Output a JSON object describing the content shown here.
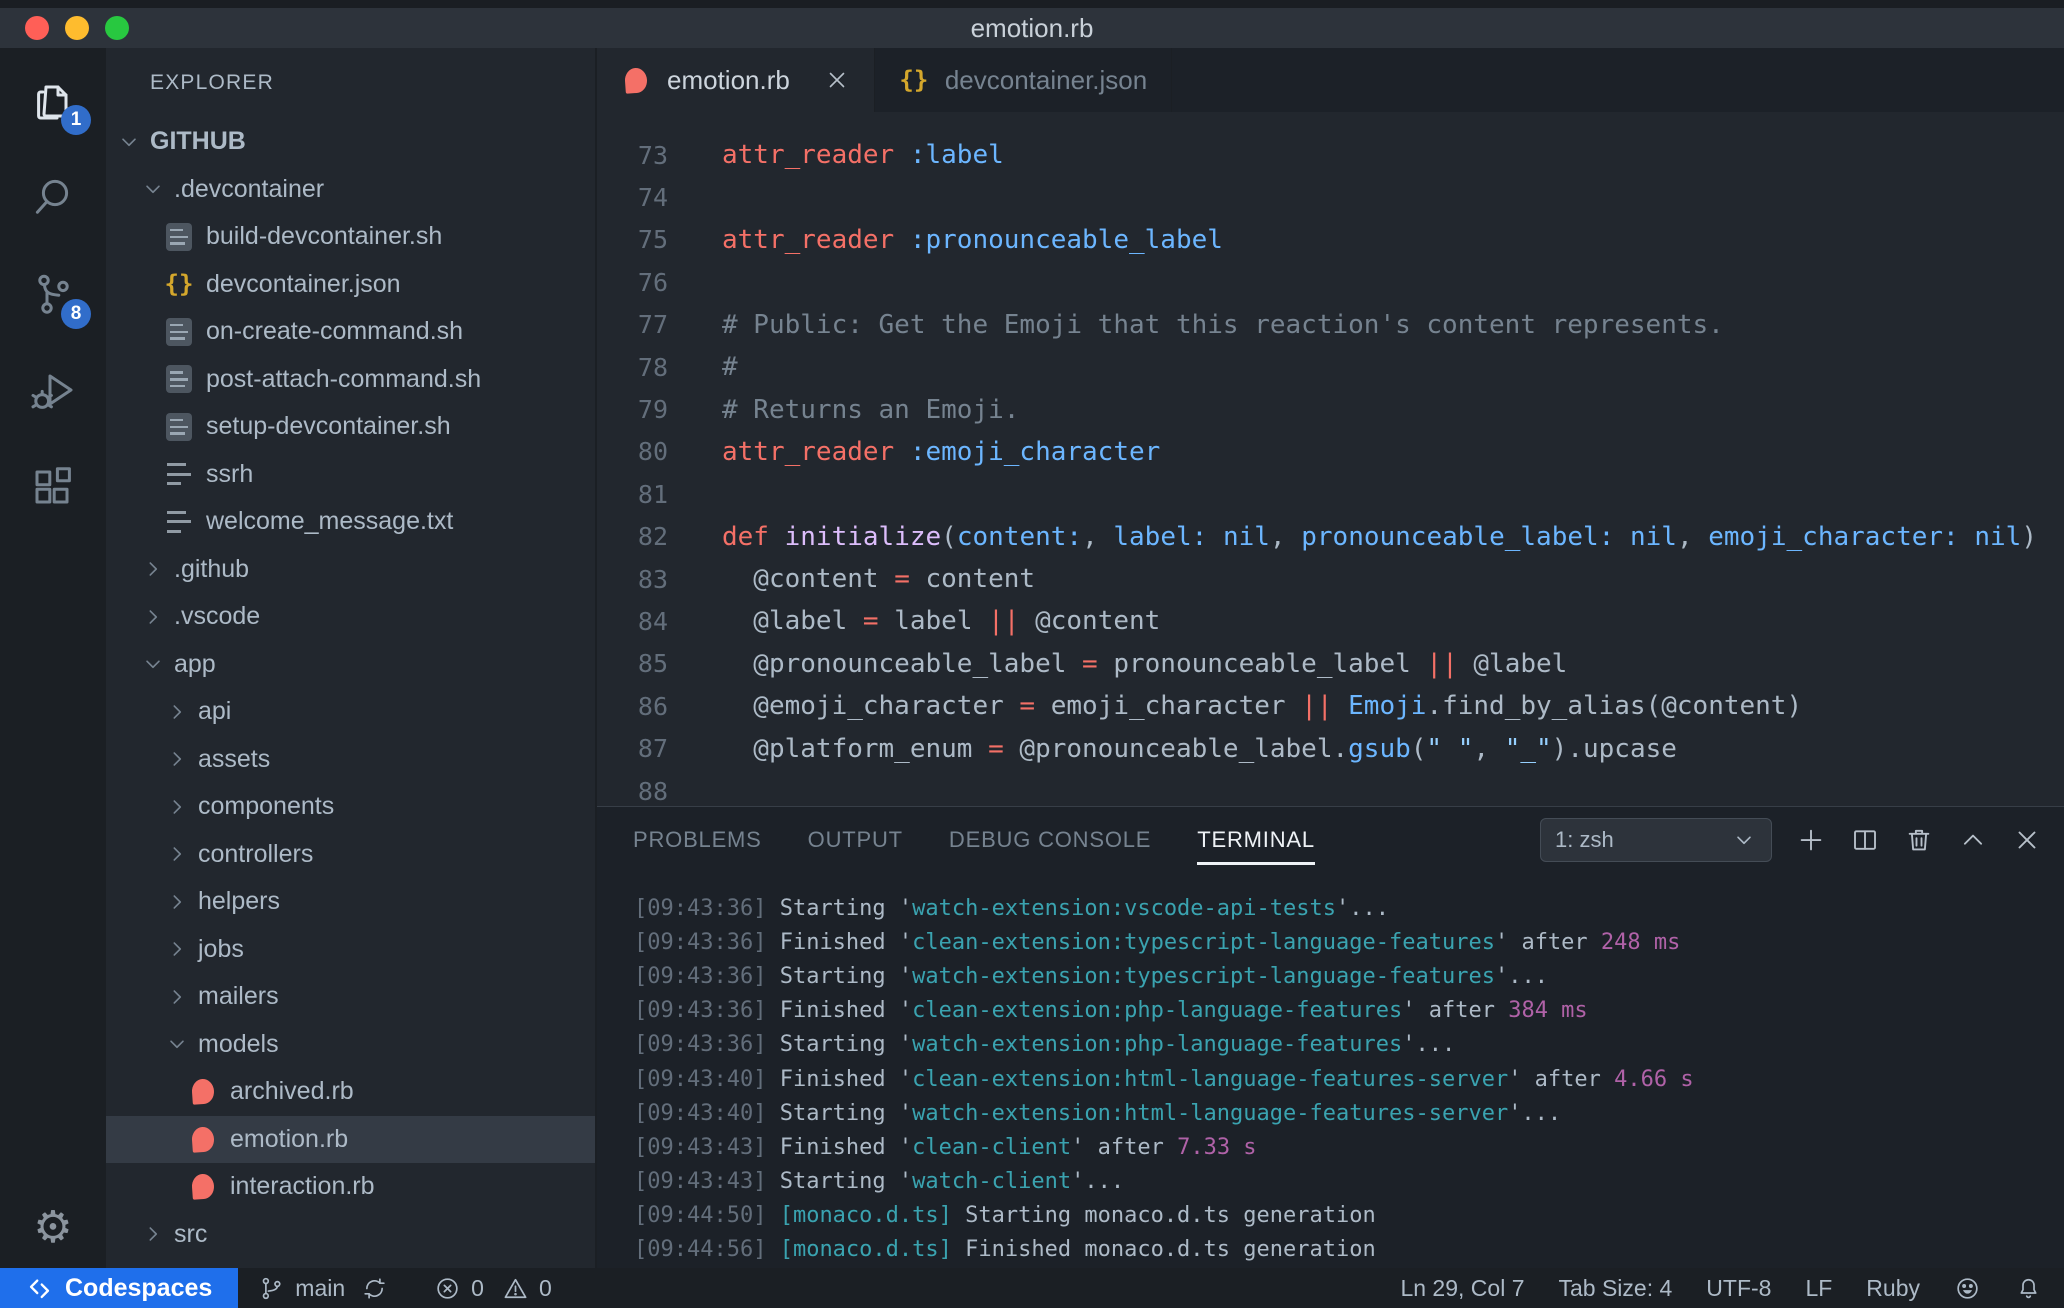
{
  "window": {
    "title": "emotion.rb"
  },
  "activity_bar": {
    "items": [
      {
        "name": "explorer",
        "badge": "1",
        "active": true
      },
      {
        "name": "search"
      },
      {
        "name": "source-control",
        "badge": "8"
      },
      {
        "name": "run-and-debug"
      },
      {
        "name": "extensions"
      }
    ],
    "settings": "settings"
  },
  "sidebar": {
    "header": "EXPLORER",
    "tree": [
      {
        "label": "GITHUB",
        "level": 0,
        "chev": "down",
        "root": true
      },
      {
        "label": ".devcontainer",
        "level": 1,
        "chev": "down"
      },
      {
        "label": "build-devcontainer.sh",
        "level": 2,
        "icon": "sh"
      },
      {
        "label": "devcontainer.json",
        "level": 2,
        "icon": "json"
      },
      {
        "label": "on-create-command.sh",
        "level": 2,
        "icon": "sh"
      },
      {
        "label": "post-attach-command.sh",
        "level": 2,
        "icon": "sh"
      },
      {
        "label": "setup-devcontainer.sh",
        "level": 2,
        "icon": "sh"
      },
      {
        "label": "ssrh",
        "level": 2,
        "icon": "txt"
      },
      {
        "label": "welcome_message.txt",
        "level": 2,
        "icon": "txt"
      },
      {
        "label": ".github",
        "level": 1,
        "chev": "right"
      },
      {
        "label": ".vscode",
        "level": 1,
        "chev": "right"
      },
      {
        "label": "app",
        "level": 1,
        "chev": "down"
      },
      {
        "label": "api",
        "level": 2,
        "chev": "right"
      },
      {
        "label": "assets",
        "level": 2,
        "chev": "right"
      },
      {
        "label": "components",
        "level": 2,
        "chev": "right"
      },
      {
        "label": "controllers",
        "level": 2,
        "chev": "right"
      },
      {
        "label": "helpers",
        "level": 2,
        "chev": "right"
      },
      {
        "label": "jobs",
        "level": 2,
        "chev": "right"
      },
      {
        "label": "mailers",
        "level": 2,
        "chev": "right"
      },
      {
        "label": "models",
        "level": 2,
        "chev": "down"
      },
      {
        "label": "archived.rb",
        "level": 3,
        "icon": "ruby"
      },
      {
        "label": "emotion.rb",
        "level": 3,
        "icon": "ruby",
        "selected": true
      },
      {
        "label": "interaction.rb",
        "level": 3,
        "icon": "ruby"
      },
      {
        "label": "src",
        "level": 1,
        "chev": "right"
      }
    ]
  },
  "editor": {
    "tabs": [
      {
        "label": "emotion.rb",
        "icon": "ruby",
        "active": true,
        "closable": true
      },
      {
        "label": "devcontainer.json",
        "icon": "json"
      }
    ],
    "lines": [
      {
        "no": 73,
        "segs": [
          [
            "attr_reader",
            "red"
          ],
          [
            " ",
            "fg"
          ],
          [
            ":label",
            "blue"
          ]
        ]
      },
      {
        "no": 74,
        "segs": []
      },
      {
        "no": 75,
        "segs": [
          [
            "attr_reader",
            "red"
          ],
          [
            " ",
            "fg"
          ],
          [
            ":pronounceable_label",
            "blue"
          ]
        ]
      },
      {
        "no": 76,
        "segs": []
      },
      {
        "no": 77,
        "segs": [
          [
            "# Public: Get the Emoji that this reaction's content represents.",
            "comment"
          ]
        ]
      },
      {
        "no": 78,
        "segs": [
          [
            "#",
            "comment"
          ]
        ]
      },
      {
        "no": 79,
        "segs": [
          [
            "# Returns an Emoji.",
            "comment"
          ]
        ]
      },
      {
        "no": 80,
        "segs": [
          [
            "attr_reader",
            "red"
          ],
          [
            " ",
            "fg"
          ],
          [
            ":emoji_character",
            "blue"
          ]
        ]
      },
      {
        "no": 81,
        "segs": []
      },
      {
        "no": 82,
        "segs": [
          [
            "def",
            "red"
          ],
          [
            " ",
            "fg"
          ],
          [
            "initialize",
            "purple"
          ],
          [
            "(",
            "fg"
          ],
          [
            "content:",
            "blue"
          ],
          [
            ", ",
            "fg"
          ],
          [
            "label:",
            "blue"
          ],
          [
            " ",
            "fg"
          ],
          [
            "nil",
            "blue"
          ],
          [
            ", ",
            "fg"
          ],
          [
            "pronounceable_label:",
            "blue"
          ],
          [
            " ",
            "fg"
          ],
          [
            "nil",
            "blue"
          ],
          [
            ", ",
            "fg"
          ],
          [
            "emoji_character:",
            "blue"
          ],
          [
            " ",
            "fg"
          ],
          [
            "nil",
            "blue"
          ],
          [
            ")",
            "fg"
          ]
        ]
      },
      {
        "no": 83,
        "segs": [
          [
            "  @content ",
            "fg"
          ],
          [
            "=",
            "red"
          ],
          [
            " content",
            "fg"
          ]
        ]
      },
      {
        "no": 84,
        "segs": [
          [
            "  @label ",
            "fg"
          ],
          [
            "=",
            "red"
          ],
          [
            " label ",
            "fg"
          ],
          [
            "||",
            "red"
          ],
          [
            " @content",
            "fg"
          ]
        ]
      },
      {
        "no": 85,
        "segs": [
          [
            "  @pronounceable_label ",
            "fg"
          ],
          [
            "=",
            "red"
          ],
          [
            " pronounceable_label ",
            "fg"
          ],
          [
            "||",
            "red"
          ],
          [
            " @label",
            "fg"
          ]
        ]
      },
      {
        "no": 86,
        "segs": [
          [
            "  @emoji_character ",
            "fg"
          ],
          [
            "=",
            "red"
          ],
          [
            " emoji_character ",
            "fg"
          ],
          [
            "||",
            "red"
          ],
          [
            " ",
            "fg"
          ],
          [
            "Emoji",
            "blue"
          ],
          [
            ".find_by_alias(@content)",
            "fg"
          ]
        ]
      },
      {
        "no": 87,
        "segs": [
          [
            "  @platform_enum ",
            "fg"
          ],
          [
            "=",
            "red"
          ],
          [
            " @pronounceable_label.",
            "fg"
          ],
          [
            "gsub",
            "blue"
          ],
          [
            "(",
            "fg"
          ],
          [
            "\" \"",
            "string"
          ],
          [
            ", ",
            "fg"
          ],
          [
            "\"_\"",
            "string"
          ],
          [
            ").upcase",
            "fg"
          ]
        ]
      },
      {
        "no": 88,
        "segs": []
      }
    ]
  },
  "panel": {
    "tabs": [
      {
        "label": "PROBLEMS"
      },
      {
        "label": "OUTPUT"
      },
      {
        "label": "DEBUG CONSOLE"
      },
      {
        "label": "TERMINAL",
        "active": true
      }
    ],
    "terminal_selector": "1: zsh",
    "actions": [
      "new-terminal",
      "split-terminal",
      "kill-terminal",
      "maximize-panel",
      "close-panel"
    ],
    "terminal_lines": [
      {
        "segs": [
          [
            "[09:43:36] ",
            "gray"
          ],
          [
            "Starting '",
            "fg"
          ],
          [
            "watch-extension:vscode-api-tests",
            "cyan"
          ],
          [
            "'...",
            "fg"
          ]
        ]
      },
      {
        "segs": [
          [
            "[09:43:36] ",
            "gray"
          ],
          [
            "Finished '",
            "fg"
          ],
          [
            "clean-extension:typescript-language-features",
            "cyan"
          ],
          [
            "' after ",
            "fg"
          ],
          [
            "248 ms",
            "magenta"
          ]
        ]
      },
      {
        "segs": [
          [
            "[09:43:36] ",
            "gray"
          ],
          [
            "Starting '",
            "fg"
          ],
          [
            "watch-extension:typescript-language-features",
            "cyan"
          ],
          [
            "'...",
            "fg"
          ]
        ]
      },
      {
        "segs": [
          [
            "[09:43:36] ",
            "gray"
          ],
          [
            "Finished '",
            "fg"
          ],
          [
            "clean-extension:php-language-features",
            "cyan"
          ],
          [
            "' after ",
            "fg"
          ],
          [
            "384 ms",
            "magenta"
          ]
        ]
      },
      {
        "segs": [
          [
            "[09:43:36] ",
            "gray"
          ],
          [
            "Starting '",
            "fg"
          ],
          [
            "watch-extension:php-language-features",
            "cyan"
          ],
          [
            "'...",
            "fg"
          ]
        ]
      },
      {
        "segs": [
          [
            "[09:43:40] ",
            "gray"
          ],
          [
            "Finished '",
            "fg"
          ],
          [
            "clean-extension:html-language-features-server",
            "cyan"
          ],
          [
            "' after ",
            "fg"
          ],
          [
            "4.66 s",
            "magenta"
          ]
        ]
      },
      {
        "segs": [
          [
            "[09:43:40] ",
            "gray"
          ],
          [
            "Starting '",
            "fg"
          ],
          [
            "watch-extension:html-language-features-server",
            "cyan"
          ],
          [
            "'...",
            "fg"
          ]
        ]
      },
      {
        "segs": [
          [
            "[09:43:43] ",
            "gray"
          ],
          [
            "Finished '",
            "fg"
          ],
          [
            "clean-client",
            "cyan"
          ],
          [
            "' after ",
            "fg"
          ],
          [
            "7.33 s",
            "magenta"
          ]
        ]
      },
      {
        "segs": [
          [
            "[09:43:43] ",
            "gray"
          ],
          [
            "Starting '",
            "fg"
          ],
          [
            "watch-client",
            "cyan"
          ],
          [
            "'...",
            "fg"
          ]
        ]
      },
      {
        "segs": [
          [
            "[09:44:50] ",
            "gray"
          ],
          [
            "[monaco.d.ts]",
            "cyan"
          ],
          [
            " Starting monaco.d.ts generation",
            "fg"
          ]
        ]
      },
      {
        "segs": [
          [
            "[09:44:56] ",
            "gray"
          ],
          [
            "[monaco.d.ts]",
            "cyan"
          ],
          [
            " Finished monaco.d.ts generation",
            "fg"
          ]
        ]
      }
    ]
  },
  "status_bar": {
    "remote": "Codespaces",
    "branch": "main",
    "errors": "0",
    "warnings": "0",
    "right": [
      {
        "name": "cursor-position",
        "label": "Ln 29, Col 7"
      },
      {
        "name": "tab-size",
        "label": "Tab Size: 4"
      },
      {
        "name": "encoding",
        "label": "UTF-8"
      },
      {
        "name": "eol",
        "label": "LF"
      },
      {
        "name": "language-mode",
        "label": "Ruby"
      }
    ]
  },
  "colors": {
    "syntax": {
      "red": "#f47067",
      "purple": "#dcbdfb",
      "blue": "#6cb6ff",
      "string": "#96d0ff",
      "comment": "#768390",
      "fg": "#adbac7"
    },
    "terminal": {
      "gray": "#636e7b",
      "fg": "#adbac7",
      "cyan": "#3aa3b0",
      "magenta": "#b062a8"
    },
    "badge": "#316dca",
    "remote_background": "#1f6feb",
    "ruby_icon": "#f47067",
    "json_icon": "#d4a72c"
  }
}
